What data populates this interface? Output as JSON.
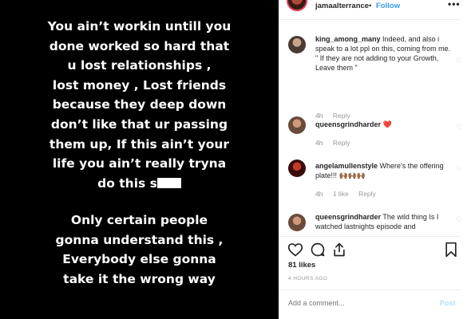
{
  "story": {
    "block1": [
      "You ain’t workin untill you",
      "done worked so hard that",
      "u lost relationships ,",
      "lost money , Lost friends",
      "because they deep down",
      "don’t like that ur passing",
      "them up, If this ain’t your",
      "life you ain’t really tryna",
      "do this s"
    ],
    "block2": [
      "Only certain people",
      "gonna understand this ,",
      "Everybody else gonna",
      "take it the wrong way"
    ]
  },
  "header": {
    "username": "jamaalterrance",
    "separator": "•",
    "follow_label": "Follow",
    "more_label": "•••"
  },
  "comments": [
    {
      "user": "king_among_many",
      "text": "Indeed, and also i speak to a lot ppl on this, coming from me. \" If they are not adding to your Growth, Leave them \"",
      "time": "4h",
      "likes": "",
      "reply": "Reply"
    },
    {
      "user": "queensgrindharder",
      "text": "❤️",
      "time": "4h",
      "likes": "",
      "reply": "Reply"
    },
    {
      "user": "angelamullenstyle",
      "text": "Where's the offering plate!!! 🙌🏾🙌🏾🙌🏾",
      "time": "4h",
      "likes": "1 like",
      "reply": "Reply"
    },
    {
      "user": "queensgrindharder",
      "text": "The wild thing Is I watched lastnights episode and",
      "time": "",
      "likes": "",
      "reply": ""
    }
  ],
  "engagement": {
    "likes_label": "81 likes",
    "posted": "4 HOURS AGO"
  },
  "composer": {
    "placeholder": "Add a comment...",
    "post_label": "Post"
  },
  "colors": {
    "link_blue": "#3897f0",
    "heart_red": "#ed4956",
    "muted": "#999999"
  }
}
